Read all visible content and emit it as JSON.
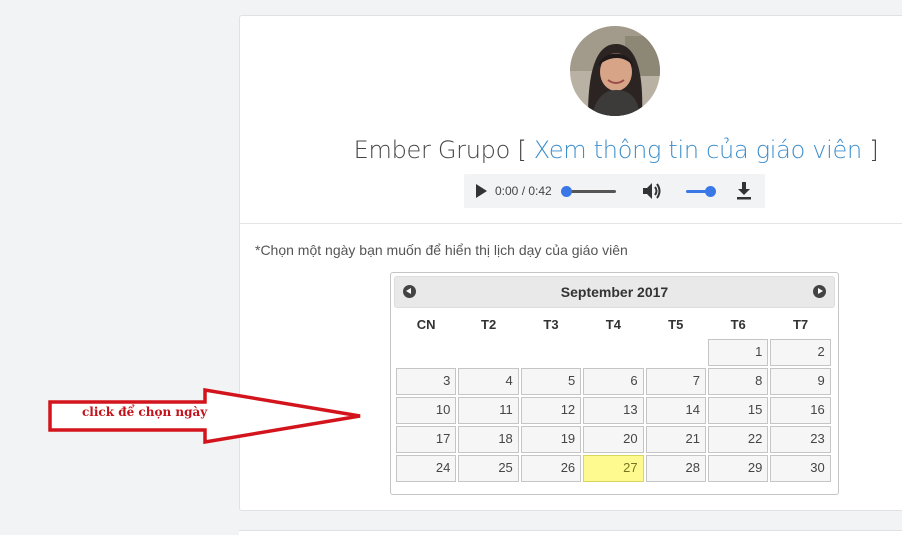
{
  "teacher": {
    "name": "Ember Grupo",
    "bracket_open": "[",
    "bracket_close": "]",
    "profile_link": "Xem thông tin của giáo viên"
  },
  "audio": {
    "time": "0:00 / 0:42",
    "progress": 0,
    "volume": 1
  },
  "instruction": "*Chọn một ngày bạn muốn để hiển thị lịch dạy của giáo viên",
  "calendar": {
    "title": "September 2017",
    "weekdays": [
      "CN",
      "T2",
      "T3",
      "T4",
      "T5",
      "T6",
      "T7"
    ],
    "first_weekday_index": 5,
    "days": [
      "1",
      "2",
      "3",
      "4",
      "5",
      "6",
      "7",
      "8",
      "9",
      "10",
      "11",
      "12",
      "13",
      "14",
      "15",
      "16",
      "17",
      "18",
      "19",
      "20",
      "21",
      "22",
      "23",
      "24",
      "25",
      "26",
      "27",
      "28",
      "29",
      "30"
    ],
    "highlighted_day": "27",
    "highlight_color": "#fffa90"
  },
  "annotation": {
    "label": "click để chọn ngày",
    "color": "#d3141c"
  }
}
